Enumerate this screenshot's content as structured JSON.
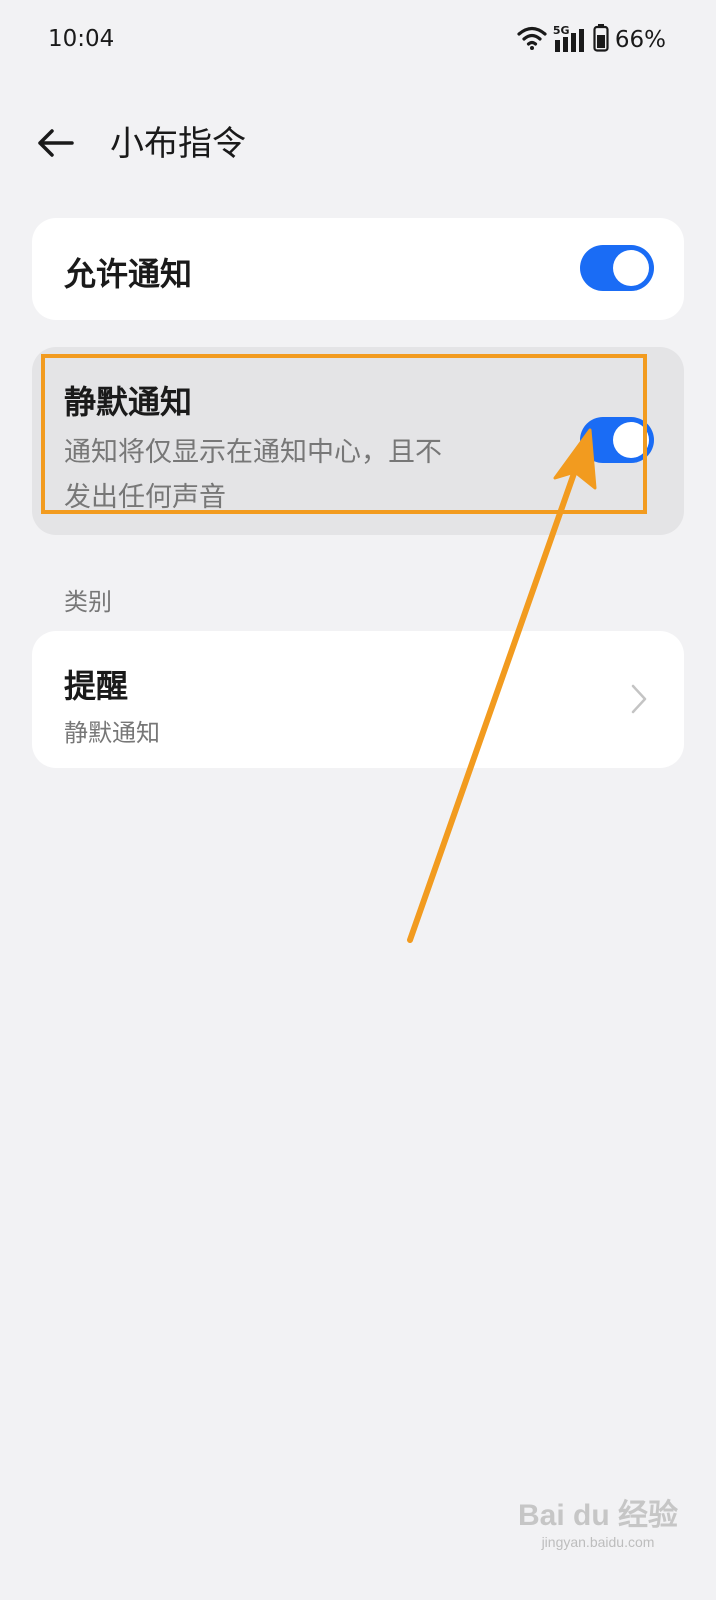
{
  "status_bar": {
    "time": "10:04",
    "network": "5G",
    "battery": "66%",
    "icons": [
      "wifi-icon",
      "cellular-signal-icon",
      "battery-icon"
    ]
  },
  "header": {
    "back_icon": "back-arrow-icon",
    "title": "小布指令"
  },
  "settings": {
    "allow_notifications": {
      "label": "允许通知",
      "enabled": true
    },
    "silent_notifications": {
      "label": "静默通知",
      "description_line1": "通知将仅显示在通知中心，且不",
      "description_line2": "发出任何声音",
      "enabled": true
    }
  },
  "category": {
    "section_label": "类别",
    "items": [
      {
        "title": "提醒",
        "subtitle": "静默通知",
        "icon": "chevron-right-icon"
      }
    ]
  },
  "annotation": {
    "color": "#f29b1f"
  },
  "watermark": {
    "main": "Bai du 经验",
    "sub": "jingyan.baidu.com"
  },
  "colors": {
    "accent": "#1a6cf5",
    "background": "#f2f2f4",
    "card": "#ffffff"
  }
}
